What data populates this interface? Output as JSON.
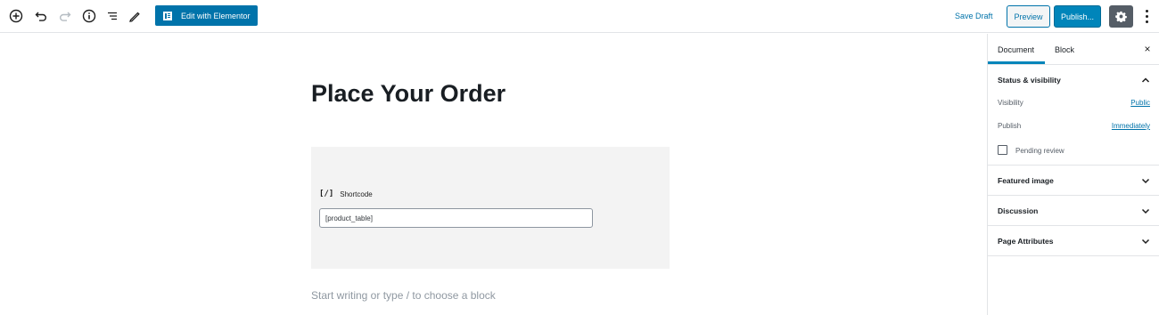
{
  "toolbar": {
    "icons": [
      "add-block-icon",
      "undo-icon",
      "redo-icon",
      "info-icon",
      "outline-icon",
      "tools-icon"
    ],
    "elementor_label": "Edit with Elementor",
    "save_draft_label": "Save Draft",
    "preview_label": "Preview",
    "publish_label": "Publish...",
    "accent_color": "#0073aa"
  },
  "editor": {
    "title": "Place Your Order",
    "shortcode": {
      "icon": "[/]",
      "label": "Shortcode",
      "value": "[product_table]"
    },
    "placeholder": "Start writing or type / to choose a block"
  },
  "sidebar": {
    "tabs": [
      {
        "label": "Document",
        "active": true
      },
      {
        "label": "Block",
        "active": false
      }
    ],
    "close_label": "×",
    "status_panel": {
      "title": "Status & visibility",
      "expanded": true,
      "visibility_label": "Visibility",
      "visibility_value": "Public",
      "publish_label": "Publish",
      "publish_value": "Immediately",
      "pending_label": "Pending review",
      "pending_checked": false
    },
    "panels": [
      {
        "title": "Featured image",
        "expanded": false
      },
      {
        "title": "Discussion",
        "expanded": false
      },
      {
        "title": "Page Attributes",
        "expanded": false
      }
    ]
  }
}
